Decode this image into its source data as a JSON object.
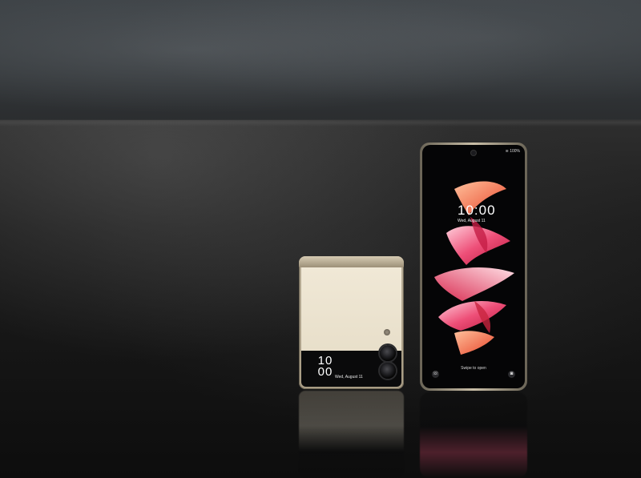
{
  "cover_screen": {
    "hour": "10",
    "minute": "00",
    "date": "Wed, August 11"
  },
  "main_screen": {
    "status": "100%",
    "time": "10:00",
    "date": "Wed, August 11",
    "unlock_hint": "Swipe to open"
  },
  "colors": {
    "phone_cream": "#ece3cf",
    "frame_gold": "#b8ad97",
    "wallpaper_pink": "#ee4f78",
    "wallpaper_orange": "#f26a3a"
  }
}
